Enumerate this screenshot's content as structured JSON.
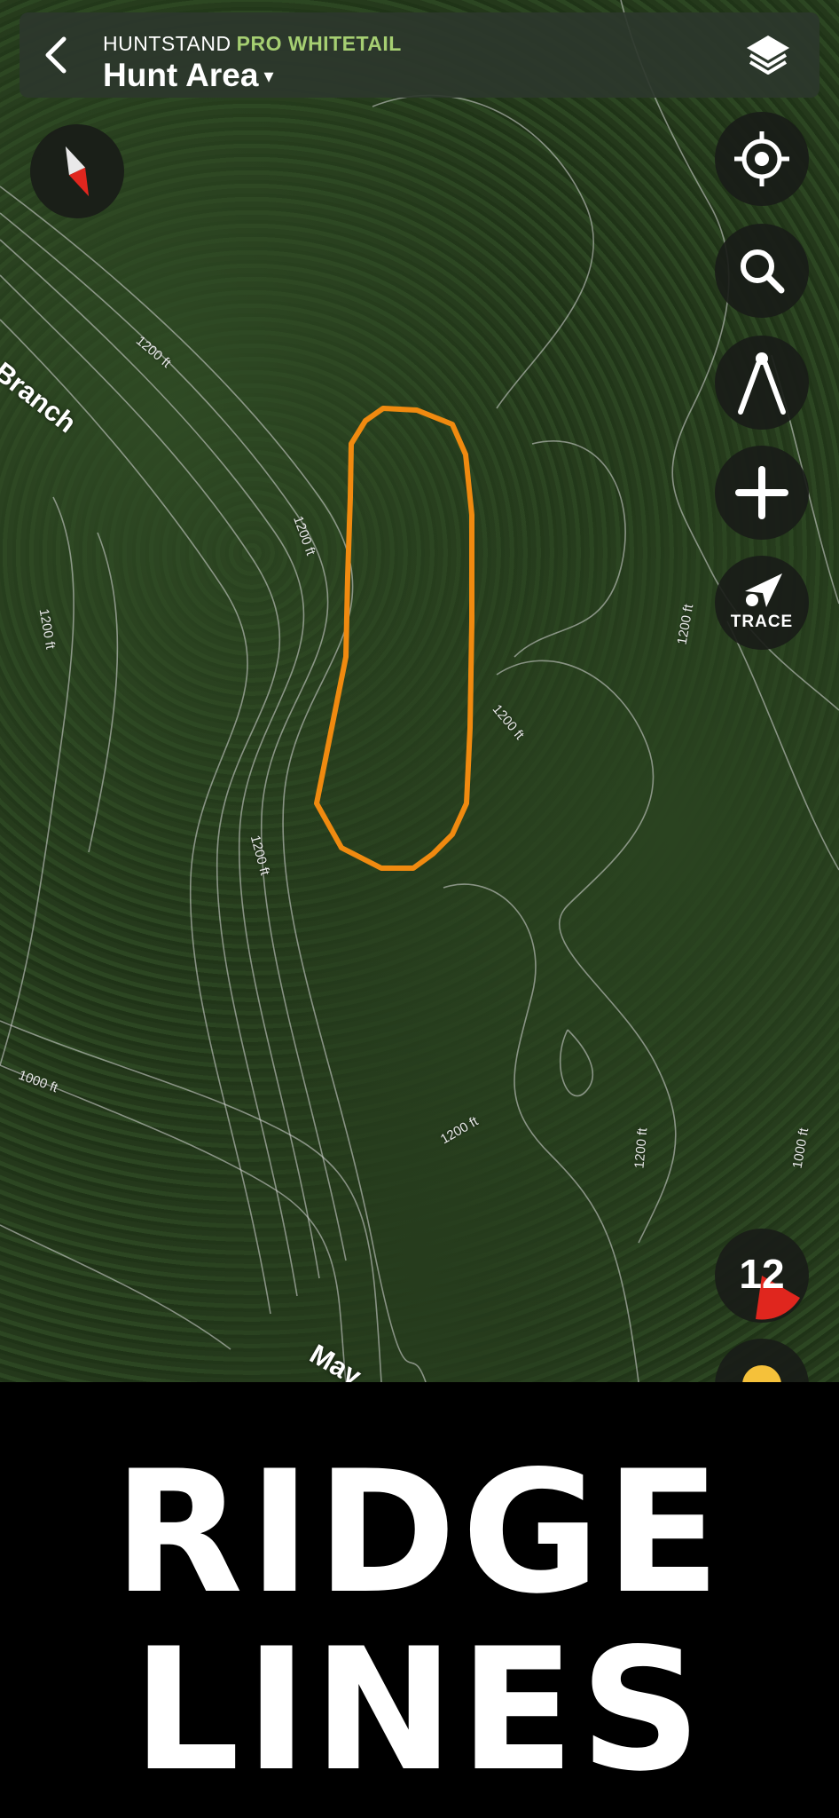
{
  "header": {
    "brand": "HUNTSTAND",
    "tier": "PRO WHITETAIL",
    "title": "Hunt Area",
    "caret": "▾",
    "back_icon": "chevron-left-icon",
    "layers_icon": "layers-icon"
  },
  "controls": {
    "compass_icon": "compass-icon",
    "locate_icon": "crosshair-icon",
    "search_icon": "search-icon",
    "measure_icon": "measure-icon",
    "add_icon": "plus-icon",
    "trace_label": "TRACE",
    "zoom_level": "12"
  },
  "map": {
    "place_labels": [
      "Branch",
      "May"
    ],
    "contour_labels": [
      "1200 ft",
      "1200 ft",
      "1200 ft",
      "1200 ft",
      "1200 ft",
      "1200 ft",
      "1200 ft",
      "1000 ft",
      "1000 ft"
    ],
    "colors": {
      "hunt_area_outline": "#f08a10",
      "contour": "#d8d8d8",
      "zoom_indicator": "#e0261e",
      "tier_accent": "#a6cf72"
    }
  },
  "caption": {
    "line1": "RIDGE",
    "line2": "LINES"
  }
}
